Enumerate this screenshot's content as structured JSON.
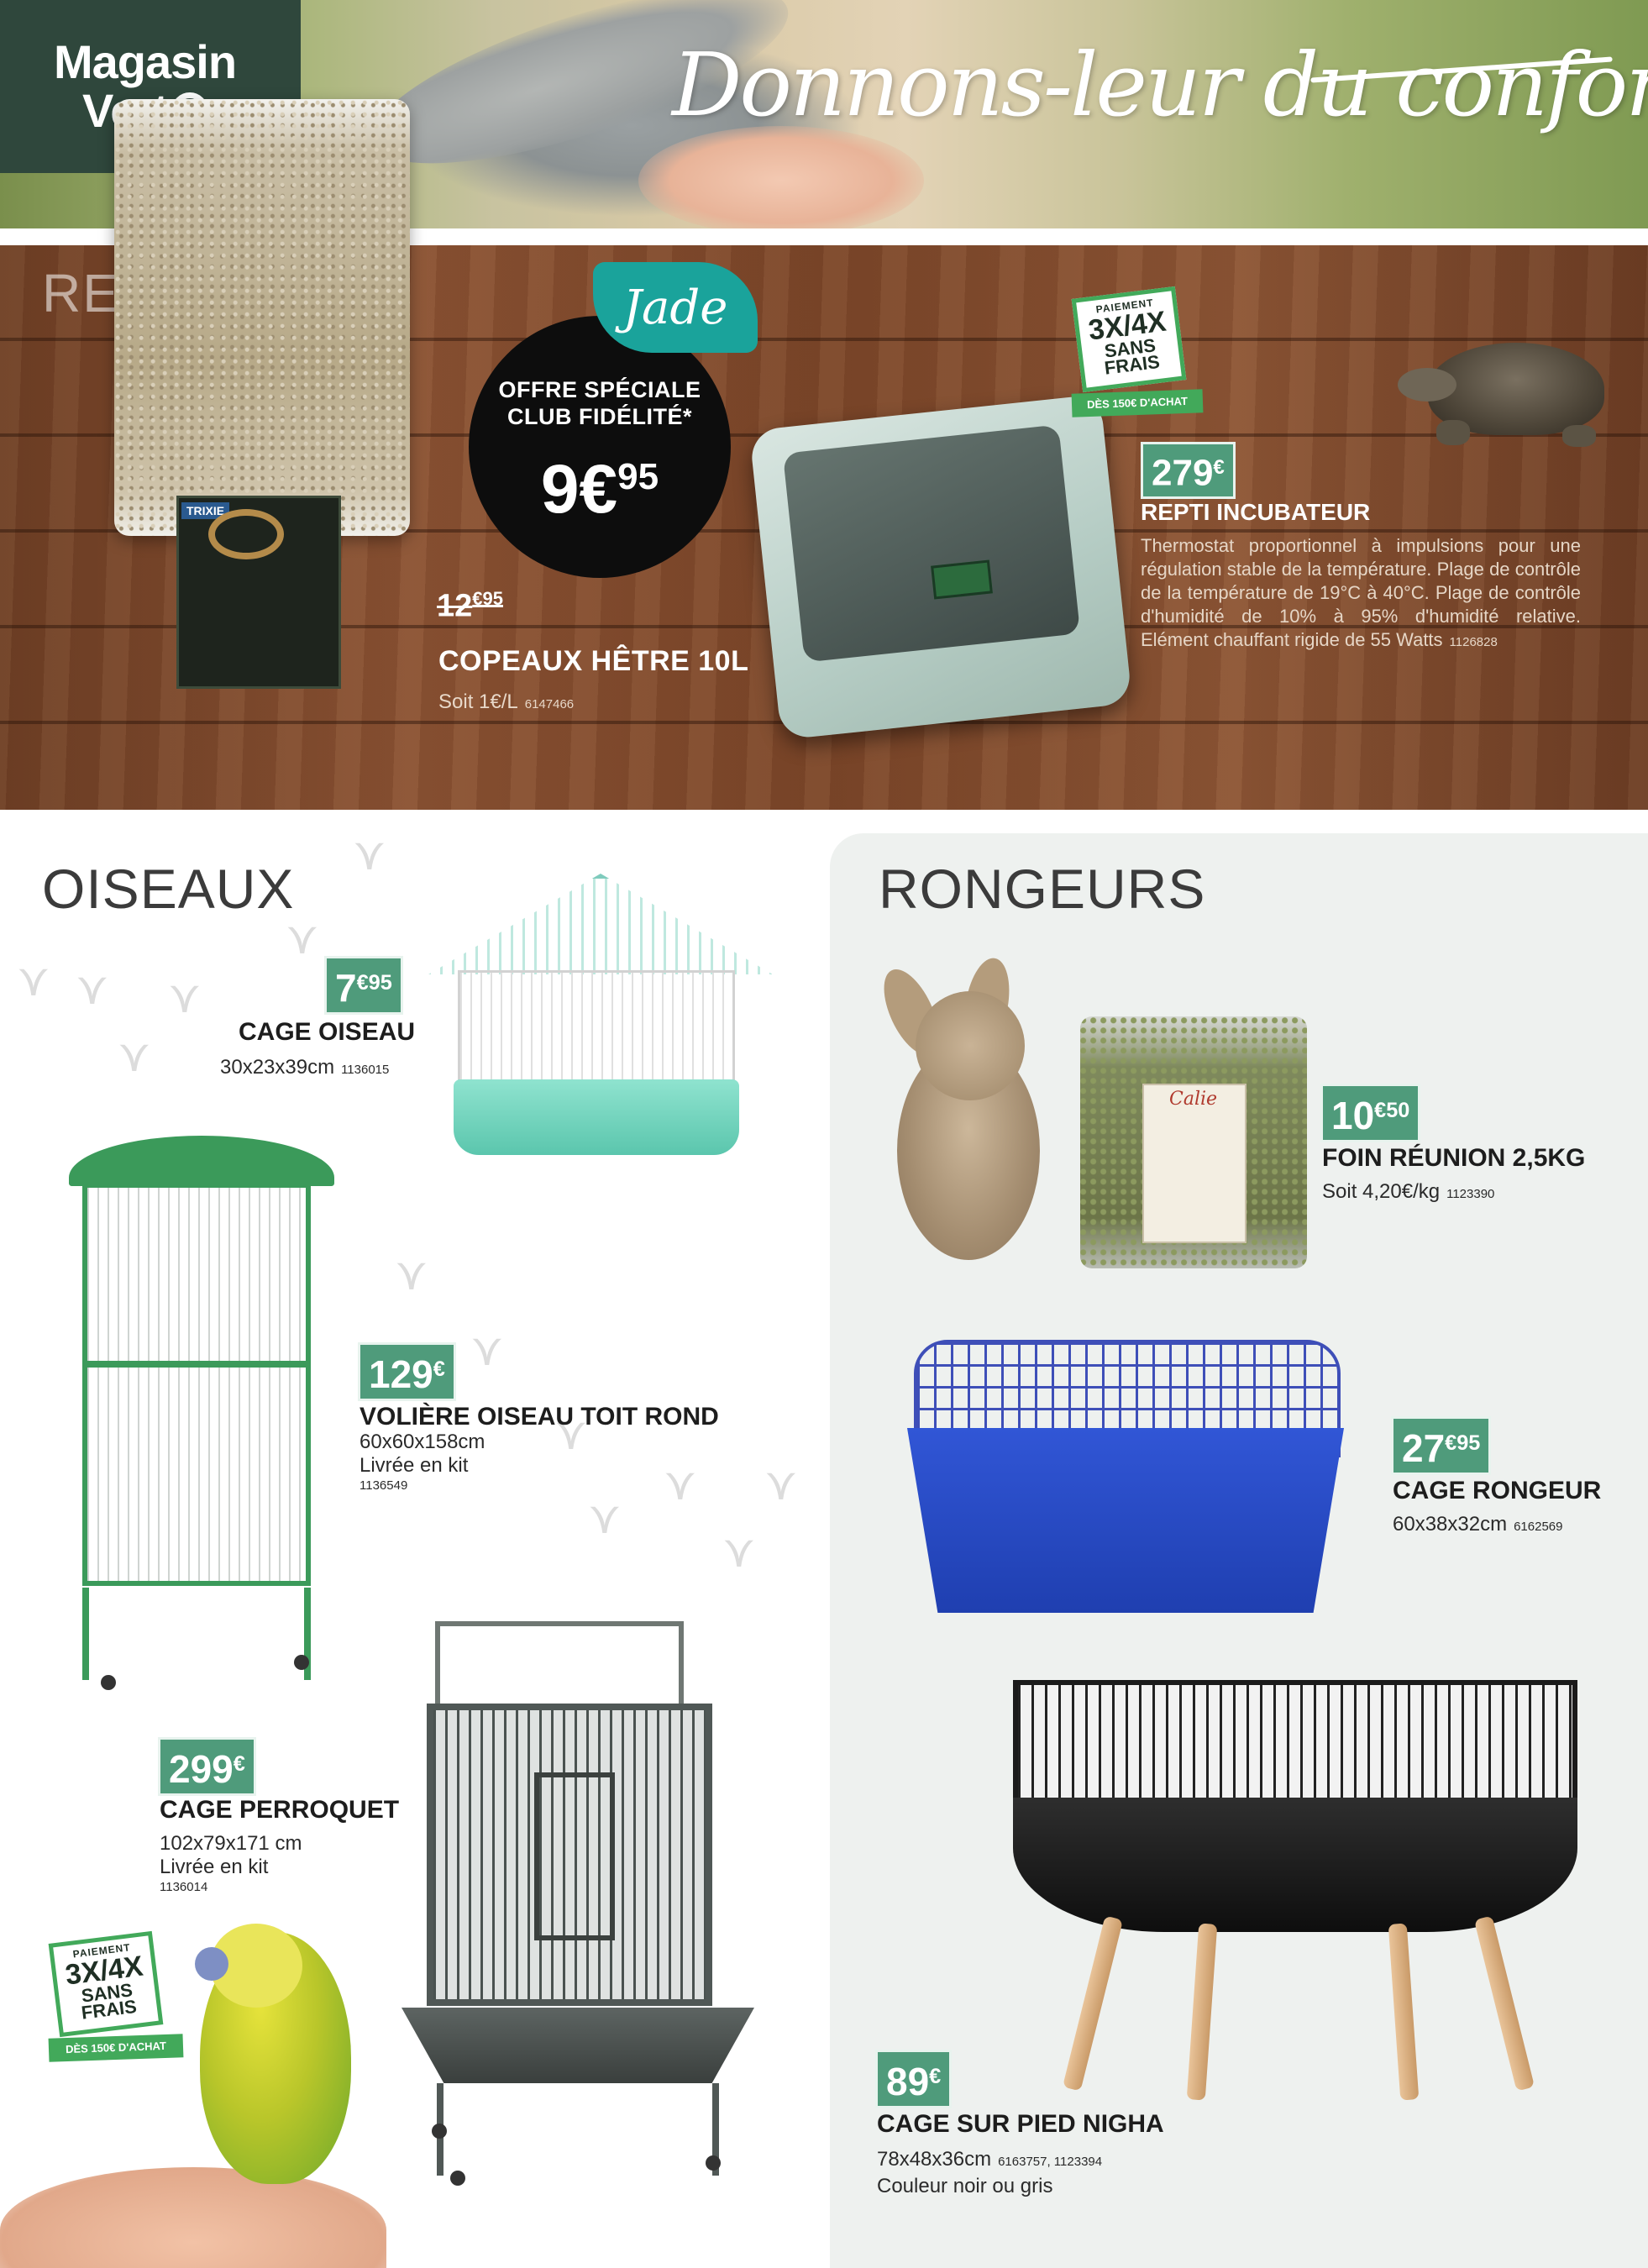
{
  "header": {
    "logo_line1": "Magasin",
    "logo_line2": "Vert",
    "tagline": "Donnons-leur du confort"
  },
  "reptiles": {
    "title": "REPTILES",
    "club_badge": "Jade",
    "offer": {
      "title_line1": "OFFRE SPÉCIALE",
      "title_line2": "CLUB FIDÉLITÉ*",
      "price_int": "9€",
      "price_dec": "95"
    },
    "copeaux": {
      "old_price_int": "12",
      "old_price_dec": "€95",
      "name": "COPEAUX HÊTRE 10L",
      "unit_price": "Soit 1€/L",
      "ref": "6147466",
      "bag_brand": "TRIXIE"
    },
    "payment_badge": {
      "line1": "PAIEMENT",
      "line2": "3X/4X",
      "line3": "SANS",
      "line4": "FRAIS",
      "footer": "DÈS 150€ D'ACHAT"
    },
    "incubateur": {
      "price_int": "279",
      "price_sup": "€",
      "name": "REPTI INCUBATEUR",
      "description": "Thermostat proportionnel à impulsions pour une régulation stable de la température. Plage de contrôle de la température de 19°C à 40°C. Plage de contrôle d'humidité de 10% à 95% d'humidité relative. Elément chauffant rigide de 55 Watts",
      "ref": "1126828"
    }
  },
  "oiseaux": {
    "title": "OISEAUX",
    "cage_oiseau": {
      "price_int": "7",
      "price_sup": "€95",
      "name": "CAGE OISEAU",
      "dims": "30x23x39cm",
      "ref": "1136015"
    },
    "voliere": {
      "price_int": "129",
      "price_sup": "€",
      "name": "VOLIÈRE OISEAU TOIT ROND",
      "dims": "60x60x158cm",
      "kit": "Livrée en kit",
      "ref": "1136549"
    },
    "perroquet": {
      "price_int": "299",
      "price_sup": "€",
      "name": "CAGE PERROQUET",
      "dims": "102x79x171 cm",
      "kit": "Livrée en kit",
      "ref": "1136014"
    },
    "payment_badge": {
      "line1": "PAIEMENT",
      "line2": "3X/4X",
      "line3": "SANS",
      "line4": "FRAIS",
      "footer": "DÈS 150€ D'ACHAT"
    }
  },
  "rongeurs": {
    "title": "RONGEURS",
    "foin": {
      "price_int": "10",
      "price_sup": "€50",
      "name": "FOIN RÉUNION 2,5KG",
      "unit_price": "Soit 4,20€/kg",
      "ref": "1123390",
      "bag_brand": "Calie"
    },
    "cage_rongeur": {
      "price_int": "27",
      "price_sup": "€95",
      "name": "CAGE RONGEUR",
      "dims": "60x38x32cm",
      "ref": "6162569"
    },
    "nigha": {
      "price_int": "89",
      "price_sup": "€",
      "name": "CAGE SUR PIED NIGHA",
      "dims": "78x48x36cm",
      "ref": "6163757, 1123394",
      "color": "Couleur noir ou gris"
    }
  },
  "colors": {
    "brand_dark_green": "#2f473c",
    "price_green": "#4f9b7b",
    "club_teal": "#1aa39b",
    "payment_green": "#42a95a",
    "wood": "#7b4629"
  }
}
